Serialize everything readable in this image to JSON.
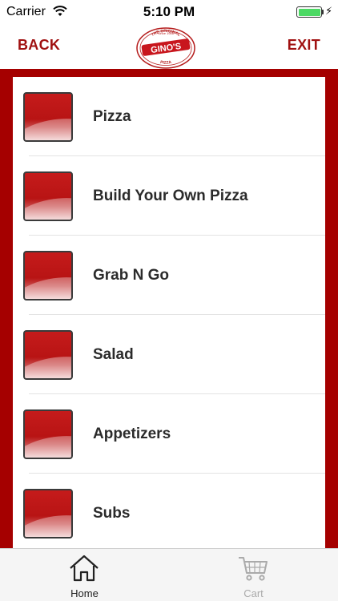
{
  "status_bar": {
    "carrier": "Carrier",
    "time": "5:10 PM",
    "battery_level": 1.0
  },
  "header": {
    "back_label": "BACK",
    "exit_label": "EXIT",
    "logo": {
      "line1": "Since 1956",
      "line2": "THE ORIGINAL",
      "brand": "GINO'S",
      "line3": "PIZZA"
    }
  },
  "menu": {
    "items": [
      {
        "label": "Pizza"
      },
      {
        "label": "Build Your Own Pizza"
      },
      {
        "label": "Grab N Go"
      },
      {
        "label": "Salad"
      },
      {
        "label": "Appetizers"
      },
      {
        "label": "Subs"
      }
    ]
  },
  "tabbar": {
    "tabs": [
      {
        "label": "Home",
        "icon": "home-icon",
        "active": true
      },
      {
        "label": "Cart",
        "icon": "cart-icon",
        "active": false
      }
    ]
  },
  "colors": {
    "brand_red": "#a50000",
    "label_red": "#a01010",
    "battery_green": "#4cd964"
  }
}
